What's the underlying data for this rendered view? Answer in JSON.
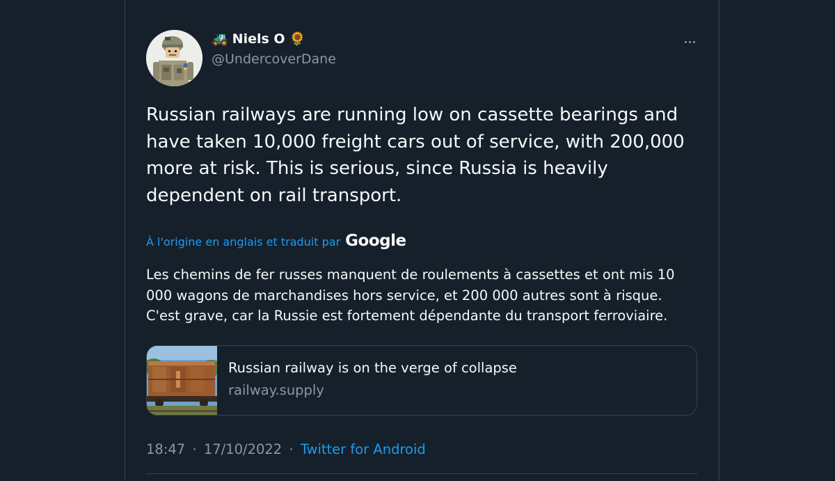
{
  "tweet": {
    "author": {
      "name_emoji_prefix": "🚜",
      "name": "Niels O",
      "name_emoji_suffix": "🌻",
      "handle": "@UndercoverDane"
    },
    "text": "Russian railways are running low on cassette bearings and have taken 10,000 freight cars out of service, with 200,000 more at risk. This is serious, since Russia is heavily dependent on rail transport.",
    "translation": {
      "label": "À l'origine en anglais et traduit par",
      "provider": "Google",
      "text": "Les chemins de fer russes manquent de roulements à cassettes et ont mis 10 000 wagons de marchandises hors service, et 200 000 autres sont à risque. C'est grave, car la Russie est fortement dépendante du transport ferroviaire."
    },
    "link_card": {
      "title": "Russian railway is on the verge of collapse",
      "domain": "railway.supply",
      "thumbnail_icon": "rusty-freight-car-image"
    },
    "meta": {
      "time": "18:47",
      "date": "17/10/2022",
      "separator": "·",
      "source": "Twitter for Android"
    }
  },
  "colors": {
    "background": "#15202b",
    "text_primary": "#f7f9f9",
    "text_secondary": "#8b98a5",
    "accent": "#1d9bf0",
    "border": "#38444d"
  }
}
